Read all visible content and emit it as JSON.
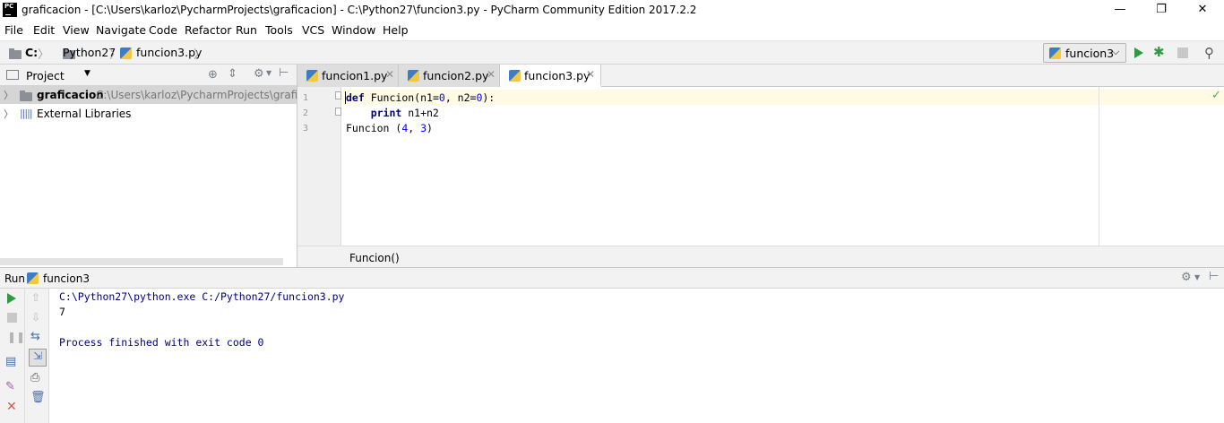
{
  "window": {
    "title": "graficacion - [C:\\Users\\karloz\\PycharmProjects\\graficacion] - C:\\Python27\\funcion3.py - PyCharm Community Edition 2017.2.2",
    "logo_text": "PC",
    "min": "—",
    "max": "❐",
    "close": "✕"
  },
  "menu": [
    "File",
    "Edit",
    "View",
    "Navigate",
    "Code",
    "Refactor",
    "Run",
    "Tools",
    "VCS",
    "Window",
    "Help"
  ],
  "breadcrumb": [
    "C:",
    "Python27",
    "funcion3.py"
  ],
  "run_config": {
    "label": "funcion3"
  },
  "project_panel": {
    "title": "Project",
    "tree": [
      {
        "label": "graficacion",
        "path": "C:\\Users\\karloz\\PycharmProjects\\graficacion"
      },
      {
        "label": "External Libraries"
      }
    ]
  },
  "tabs": [
    {
      "label": "funcion1.py"
    },
    {
      "label": "funcion2.py"
    },
    {
      "label": "funcion3.py",
      "active": true
    }
  ],
  "editor": {
    "line_numbers": [
      "1",
      "2",
      "3"
    ],
    "lines": [
      {
        "kw": "def",
        "rest": " Funcion(n1=",
        "n1": "0",
        "mid": ", n2=",
        "n2": "0",
        "end": "):"
      },
      {
        "kw": "    print",
        "rest": " n1+n2"
      },
      {
        "text": "Funcion (",
        "a": "4",
        ",": ", ",
        "b": "3",
        "close": ")"
      }
    ],
    "breadcrumb": "Funcion()"
  },
  "run_panel": {
    "title": "Run",
    "config": "funcion3",
    "output": [
      "C:\\Python27\\python.exe C:/Python27/funcion3.py",
      "7",
      "",
      "Process finished with exit code 0"
    ]
  },
  "colors": {
    "run_green": "#2f9a42",
    "keyword": "#000080",
    "number": "#0000ff",
    "stop_red": "#d9534f"
  }
}
